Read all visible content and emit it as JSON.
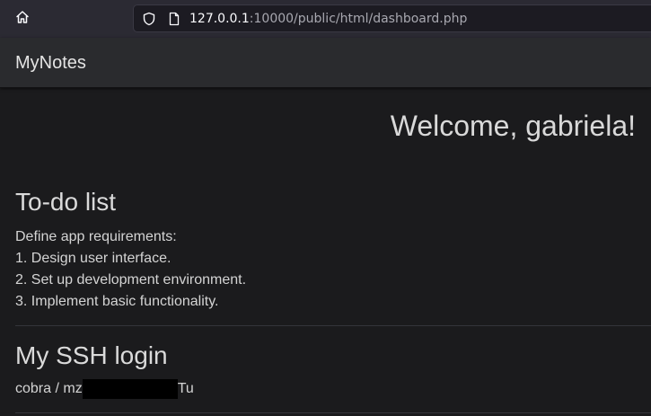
{
  "browser": {
    "home_icon": "home-icon",
    "url_host": "127.0.0.1",
    "url_rest": ":10000/public/html/dashboard.php",
    "shield_icon": "shield-icon",
    "page_icon": "page-icon"
  },
  "navbar": {
    "brand": "MyNotes"
  },
  "main": {
    "welcome": "Welcome, gabriela!",
    "todo": {
      "title": "To-do list",
      "lines": [
        "Define app requirements:",
        "1. Design user interface.",
        "2. Set up development environment.",
        "3. Implement basic functionality."
      ]
    },
    "ssh": {
      "title": "My SSH login",
      "prefix": "cobra / mz",
      "suffix": "Tu"
    }
  },
  "colors": {
    "page_bg": "#1b1b1d",
    "navbar_bg": "#2a2b2e",
    "browser_bg": "#2b2a33",
    "urlbar_bg": "#1c1b22",
    "text": "#d6d6d6"
  }
}
